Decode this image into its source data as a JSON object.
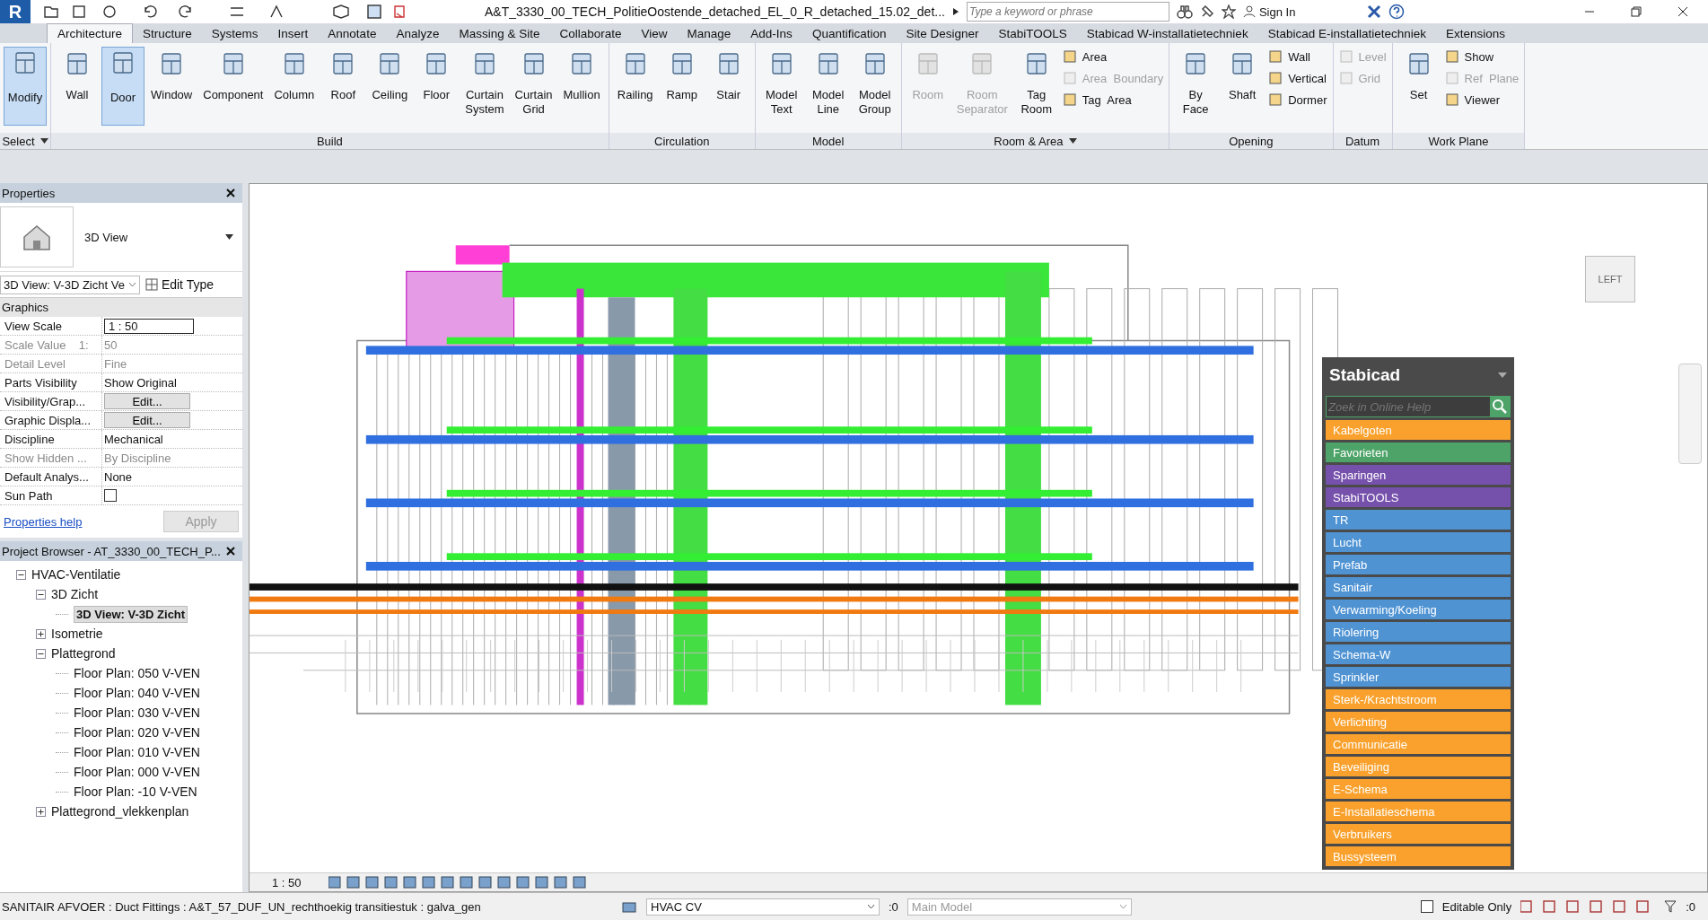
{
  "title_bar": {
    "app_logo": "R",
    "document_title": "A&T_3330_00_TECH_PolitieOostende_detached_EL_0_R_detached_15.02_det...",
    "search": {
      "placeholder": "Type a keyword or phrase"
    },
    "sign_in": "Sign In"
  },
  "ribbon_tabs": [
    {
      "label": "Architecture",
      "selected": true
    },
    {
      "label": "Structure",
      "selected": false
    },
    {
      "label": "Systems",
      "selected": false
    },
    {
      "label": "Insert",
      "selected": false
    },
    {
      "label": "Annotate",
      "selected": false
    },
    {
      "label": "Analyze",
      "selected": false
    },
    {
      "label": "Massing & Site",
      "selected": false
    },
    {
      "label": "Collaborate",
      "selected": false
    },
    {
      "label": "View",
      "selected": false
    },
    {
      "label": "Manage",
      "selected": false
    },
    {
      "label": "Add-Ins",
      "selected": false
    },
    {
      "label": "Quantification",
      "selected": false
    },
    {
      "label": "Site Designer",
      "selected": false
    },
    {
      "label": "StabiTOOLS",
      "selected": false
    },
    {
      "label": "Stabicad W-installatietechniek",
      "selected": false
    },
    {
      "label": "Stabicad E-installatietechniek",
      "selected": false
    },
    {
      "label": "Extensions",
      "selected": false
    }
  ],
  "ribbon_panels": [
    {
      "label": "Select",
      "menu": true,
      "tools": [
        {
          "label": "Modify",
          "selected": true,
          "disabled": false
        }
      ]
    },
    {
      "label": "Build",
      "menu": false,
      "tools": [
        {
          "label": "Wall",
          "selected": false,
          "disabled": false
        },
        {
          "label": "Door",
          "selected": true,
          "disabled": false
        },
        {
          "label": "Window",
          "selected": false,
          "disabled": false
        },
        {
          "label": "Component",
          "selected": false,
          "disabled": false
        },
        {
          "label": "Column",
          "selected": false,
          "disabled": false
        },
        {
          "label": "Roof",
          "selected": false,
          "disabled": false
        },
        {
          "label": "Ceiling",
          "selected": false,
          "disabled": false
        },
        {
          "label": "Floor",
          "selected": false,
          "disabled": false
        },
        {
          "label": "Curtain System",
          "selected": false,
          "disabled": false
        },
        {
          "label": "Curtain Grid",
          "selected": false,
          "disabled": false
        },
        {
          "label": "Mullion",
          "selected": false,
          "disabled": false
        }
      ]
    },
    {
      "label": "Circulation",
      "menu": false,
      "tools": [
        {
          "label": "Railing",
          "selected": false,
          "disabled": false
        },
        {
          "label": "Ramp",
          "selected": false,
          "disabled": false
        },
        {
          "label": "Stair",
          "selected": false,
          "disabled": false
        }
      ]
    },
    {
      "label": "Model",
      "menu": false,
      "tools": [
        {
          "label": "Model Text",
          "selected": false,
          "disabled": false
        },
        {
          "label": "Model Line",
          "selected": false,
          "disabled": false
        },
        {
          "label": "Model Group",
          "selected": false,
          "disabled": false
        }
      ]
    },
    {
      "label": "Room & Area",
      "menu": true,
      "tools": [
        {
          "label": "Room",
          "selected": false,
          "disabled": true
        },
        {
          "label": "Room Separator",
          "selected": false,
          "disabled": true
        },
        {
          "label": "Tag Room",
          "selected": false,
          "disabled": false
        }
      ],
      "small_tools": [
        {
          "label": "Area",
          "disabled": false
        },
        {
          "label": "Area  Boundary",
          "disabled": true
        },
        {
          "label": "Tag  Area",
          "disabled": false
        }
      ]
    },
    {
      "label": "Opening",
      "menu": false,
      "tools": [
        {
          "label": "By Face",
          "selected": false,
          "disabled": false
        },
        {
          "label": "Shaft",
          "selected": false,
          "disabled": false
        }
      ],
      "small_tools": [
        {
          "label": "Wall",
          "disabled": false
        },
        {
          "label": "Vertical",
          "disabled": false
        },
        {
          "label": "Dormer",
          "disabled": false
        }
      ]
    },
    {
      "label": "Datum",
      "menu": false,
      "small_tools": [
        {
          "label": "Level",
          "disabled": true
        },
        {
          "label": "Grid",
          "disabled": true
        }
      ]
    },
    {
      "label": "Work Plane",
      "menu": false,
      "tools": [
        {
          "label": "Set",
          "selected": false,
          "disabled": false
        }
      ],
      "small_tools": [
        {
          "label": "Show",
          "disabled": false
        },
        {
          "label": "Ref  Plane",
          "disabled": true
        },
        {
          "label": "Viewer",
          "disabled": false
        }
      ]
    }
  ],
  "properties": {
    "title": "Properties",
    "type_name": "3D View",
    "instance_selector": "3D View: V-3D Zicht Ve",
    "edit_type": "Edit Type",
    "section": "Graphics",
    "rows": [
      {
        "label": "View Scale",
        "value": "1 : 50",
        "kind": "input",
        "disabled": false
      },
      {
        "label": "Scale Value    1:",
        "value": "50",
        "kind": "text",
        "disabled": true
      },
      {
        "label": "Detail Level",
        "value": "Fine",
        "kind": "text",
        "disabled": true
      },
      {
        "label": "Parts Visibility",
        "value": "Show Original",
        "kind": "text",
        "disabled": false
      },
      {
        "label": "Visibility/Grap...",
        "value": "Edit...",
        "kind": "button",
        "disabled": false
      },
      {
        "label": "Graphic Displa...",
        "value": "Edit...",
        "kind": "button",
        "disabled": false
      },
      {
        "label": "Discipline",
        "value": "Mechanical",
        "kind": "text",
        "disabled": false
      },
      {
        "label": "Show Hidden ...",
        "value": "By Discipline",
        "kind": "text",
        "disabled": true
      },
      {
        "label": "Default Analys...",
        "value": "None",
        "kind": "text",
        "disabled": false
      },
      {
        "label": "Sun Path",
        "checked": false,
        "kind": "checkbox",
        "disabled": false
      }
    ],
    "help_link": "Properties help",
    "apply": {
      "label": "Apply",
      "disabled": true
    }
  },
  "project_browser": {
    "title": "Project Browser - AT_3330_00_TECH_P...",
    "tree": [
      {
        "label": "HVAC-Ventilatie",
        "expanded": true,
        "selected": false,
        "children": [
          {
            "label": "3D Zicht",
            "expanded": true,
            "selected": false,
            "children": [
              {
                "label": "3D View: V-3D Zicht",
                "selected": true
              }
            ]
          },
          {
            "label": "Isometrie",
            "expanded": false,
            "selected": false
          },
          {
            "label": "Plattegrond",
            "expanded": true,
            "selected": false,
            "children": [
              {
                "label": "Floor Plan: 050 V-VEN",
                "selected": false
              },
              {
                "label": "Floor Plan: 040 V-VEN",
                "selected": false
              },
              {
                "label": "Floor Plan: 030 V-VEN",
                "selected": false
              },
              {
                "label": "Floor Plan: 020 V-VEN",
                "selected": false
              },
              {
                "label": "Floor Plan: 010 V-VEN",
                "selected": false
              },
              {
                "label": "Floor Plan: 000 V-VEN",
                "selected": false
              },
              {
                "label": "Floor Plan: -10 V-VEN",
                "selected": false
              }
            ]
          },
          {
            "label": "Plattegrond_vlekkenplan",
            "expanded": false,
            "selected": false
          }
        ]
      }
    ]
  },
  "viewport": {
    "view_cube": "LEFT",
    "scale": "1 : 50"
  },
  "stabicad": {
    "title": "Stabicad",
    "search": {
      "placeholder": "Zoek in Online Help"
    },
    "items": [
      {
        "label": "Kabelgoten",
        "color": "#f9a12c"
      },
      {
        "label": "Favorieten",
        "color": "#4ea468"
      },
      {
        "label": "Sparingen",
        "color": "#7651ac"
      },
      {
        "label": "StabiTOOLS",
        "color": "#7651ac"
      },
      {
        "label": "TR",
        "color": "#4f93d3"
      },
      {
        "label": "Lucht",
        "color": "#4f93d3"
      },
      {
        "label": "Prefab",
        "color": "#4f93d3"
      },
      {
        "label": "Sanitair",
        "color": "#4f93d3"
      },
      {
        "label": "Verwarming/Koeling",
        "color": "#4f93d3"
      },
      {
        "label": "Riolering",
        "color": "#4f93d3"
      },
      {
        "label": "Schema-W",
        "color": "#4f93d3"
      },
      {
        "label": "Sprinkler",
        "color": "#4f93d3"
      },
      {
        "label": "Sterk-/Krachtstroom",
        "color": "#f9a12c"
      },
      {
        "label": "Verlichting",
        "color": "#f9a12c"
      },
      {
        "label": "Communicatie",
        "color": "#f9a12c"
      },
      {
        "label": "Beveiliging",
        "color": "#f9a12c"
      },
      {
        "label": "E-Schema",
        "color": "#f9a12c"
      },
      {
        "label": "E-Installatieschema",
        "color": "#f9a12c"
      },
      {
        "label": "Verbruikers",
        "color": "#f9a12c"
      },
      {
        "label": "Bussysteem",
        "color": "#f9a12c"
      }
    ]
  },
  "status_bar": {
    "message": "SANITAIR AFVOER : Duct Fittings : A&T_57_DUF_UN_rechthoekig transitiestuk : galva_gen",
    "workset": "HVAC CV",
    "workset_count": ":0",
    "design_option": {
      "value": "Main Model",
      "disabled": true
    },
    "editable_only": {
      "label": "Editable Only",
      "checked": false
    },
    "filter_count": ":0"
  }
}
